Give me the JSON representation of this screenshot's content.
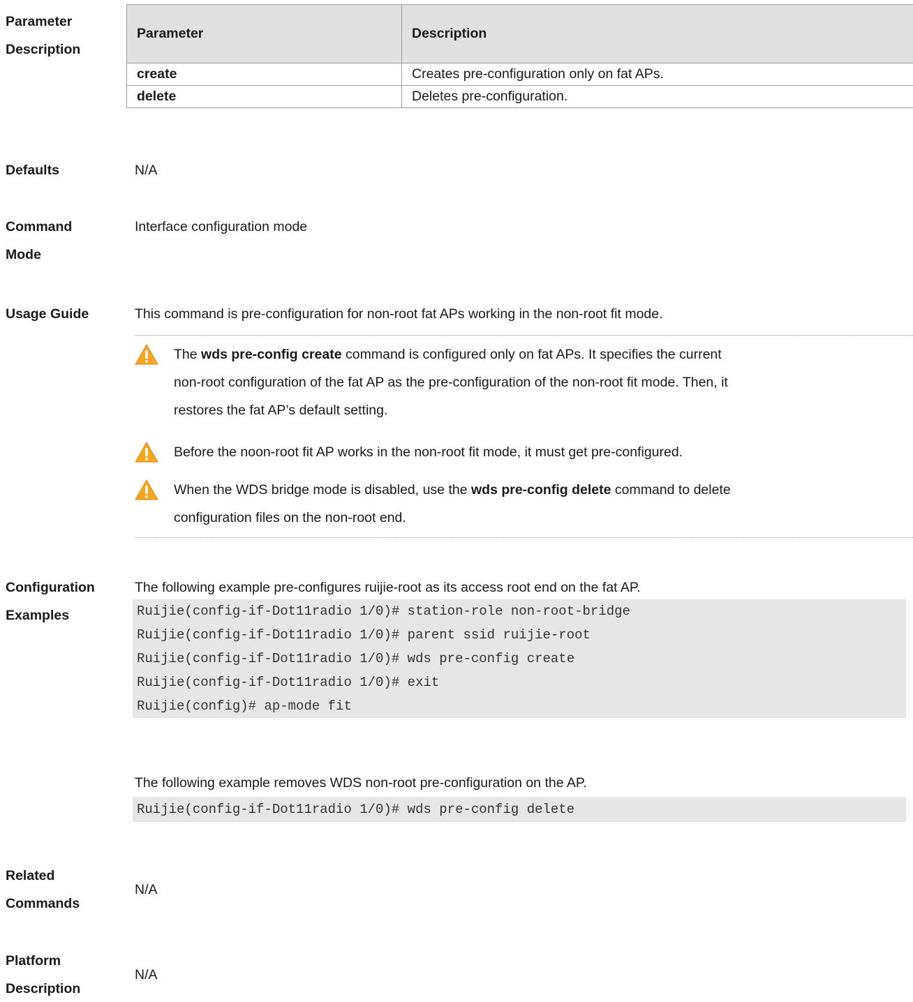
{
  "param_section": {
    "label_line1": "Parameter",
    "label_line2": "Description",
    "table": {
      "headers": [
        "Parameter",
        "Description"
      ],
      "rows": [
        {
          "param": "create",
          "desc": "Creates pre-configuration only on fat APs."
        },
        {
          "param": "delete",
          "desc": "Deletes pre-configuration."
        }
      ]
    }
  },
  "defaults": {
    "label": "Defaults",
    "value": "N/A"
  },
  "command_mode": {
    "label_line1": "Command",
    "label_line2": "Mode",
    "value": "Interface configuration mode"
  },
  "usage_guide": {
    "label": "Usage Guide",
    "intro": "This command is pre-configuration for non-root fat APs working in the non-root fit mode.",
    "notes": [
      {
        "icon": "warning-icon",
        "pre": "The ",
        "bold": "wds pre-config create",
        "post_line1": " command is configured only on fat APs. It specifies the current",
        "line2": "non-root configuration of the fat AP as the pre-configuration of the non-root fit mode. Then, it",
        "line3": "restores the fat AP’s default setting."
      },
      {
        "icon": "warning-icon",
        "text": "Before the noon-root fit AP works in the non-root fit mode, it must get pre-configured."
      },
      {
        "icon": "warning-icon",
        "pre": "When the WDS bridge mode is disabled, use the ",
        "bold": "wds pre-config delete",
        "post_line1": " command to delete",
        "line2": "configuration files on the non-root end."
      }
    ]
  },
  "config_examples": {
    "label_line1": "Configuration",
    "label_line2": "Examples",
    "example1_intro": "The following example pre-configures ruijie-root as its access root end on the fat AP.",
    "example1_code": [
      "Ruijie(config-if-Dot11radio 1/0)# station-role non-root-bridge",
      "Ruijie(config-if-Dot11radio 1/0)# parent ssid ruijie-root",
      "Ruijie(config-if-Dot11radio 1/0)# wds pre-config create",
      "Ruijie(config-if-Dot11radio 1/0)# exit",
      "Ruijie(config)# ap-mode fit"
    ],
    "example2_intro": "The following example removes WDS non-root pre-configuration on the AP.",
    "example2_code": [
      "Ruijie(config-if-Dot11radio 1/0)# wds pre-config delete"
    ]
  },
  "related_commands": {
    "label_line1": "Related",
    "label_line2": "Commands",
    "value": "N/A"
  },
  "platform_description": {
    "label_line1": "Platform",
    "label_line2": "Description",
    "value": "N/A"
  }
}
